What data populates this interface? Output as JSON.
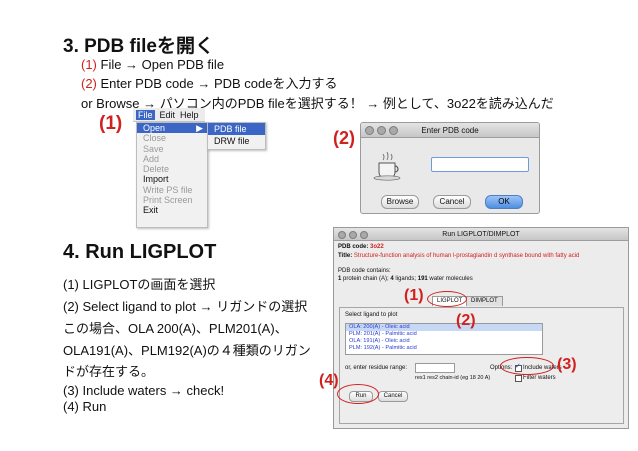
{
  "section3": {
    "heading": "3. PDB fileを開く",
    "step1_num": "(1)",
    "step1_text": " File → Open PDB file",
    "step2_num": "(2)",
    "step2_text": " Enter PDB code → PDB codeを入力する",
    "note": "or Browse → パソコン内のPDB fileを選択する！ → 例として、3o22を読み込んだ"
  },
  "labels": {
    "l1": "(1)",
    "l2": "(2)",
    "l3": "(1)",
    "l4": "(2)",
    "l5": "(3)",
    "l6": "(4)"
  },
  "menu": {
    "bar": [
      "File",
      "Edit",
      "Help"
    ],
    "items": [
      "Open",
      "Close",
      "Save",
      "Add",
      "Delete",
      "Import",
      "Write PS file",
      "Print Screen",
      "Exit"
    ],
    "submenu": [
      "PDB file",
      "DRW file"
    ]
  },
  "pdb_dialog": {
    "title": "Enter PDB code",
    "input_value": "",
    "browse": "Browse",
    "cancel": "Cancel",
    "ok": "OK"
  },
  "section4": {
    "heading": "4. Run LIGPLOT",
    "line1": "(1) LIGPLOTの画面を選択",
    "line2": "(2) Select ligand to plot → リガンドの選択",
    "line3": "この場合、OLA 200(A)、PLM201(A)、",
    "line4": "OLA191(A)、PLM192(A)の４種類のリガン",
    "line5": "ドが存在する。",
    "line6": "(3) Include waters → check!",
    "line7": "(4) Run"
  },
  "ligplot": {
    "window_title": "Run LIGPLOT/DIMPLOT",
    "pdb_label": "PDB code:",
    "pdb_value": "3o22",
    "title_label": "Title:",
    "title_value": "Structure-function analysis of human l-prostaglandin d synthase bound with fatty acid",
    "contains_label": "PDB code contains:",
    "contains_pre": "1",
    "contains_mid": " protein chain (A); ",
    "contains_lig": "4",
    "contains_mid2": " ligands; ",
    "contains_wat": "191",
    "contains_post": " water molecules",
    "tab_ligplot": "LIGPLOT",
    "tab_dimplot": "DIMPLOT",
    "select_label": "Select ligand to plot",
    "ligands": [
      "OLA: 200(A) - Oleic acid",
      "PLM:  201(A) - Palmitic acid",
      "OLA: 191(A) - Oleic acid",
      "PLM:  192(A) - Palmitic acid"
    ],
    "range_label": "or, enter residue range:",
    "range_hint": "res1 res2 chain-id (eg 18 20 A)",
    "options_label": "Options:",
    "include_waters": "Include waters",
    "filter_waters": "Filter waters",
    "run": "Run",
    "cancel": "Cancel"
  }
}
